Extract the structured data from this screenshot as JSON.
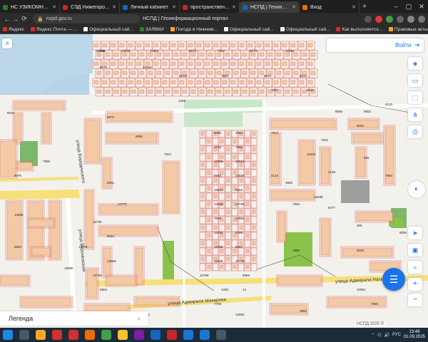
{
  "browser": {
    "tabs": [
      {
        "label": "НС УЗИКОМНО 2.4.3.",
        "color": "#2e7d32"
      },
      {
        "label": "СЭД Нижегородская",
        "color": "#c62828"
      },
      {
        "label": "Личный кабинет",
        "color": "#1565c0"
      },
      {
        "label": "пространственные д",
        "color": "#c62828"
      },
      {
        "label": "НСПД | Геоинформ",
        "color": "#1565c0",
        "active": true
      },
      {
        "label": "Вход",
        "color": "#ef6c00"
      }
    ],
    "tab_new": "+",
    "url": "nspd.gov.ru",
    "page_title": "НСПД | Геоинформационный портал",
    "bookmarks": [
      {
        "label": "Яндекс",
        "color": "#d32f2f"
      },
      {
        "label": "Яндекс.Почта — ...",
        "color": "#d32f2f"
      },
      {
        "label": "Официальный сай...",
        "color": "#ffffff"
      },
      {
        "label": "ЗАЯВКИ",
        "color": "#2e7d32"
      },
      {
        "label": "Погода в Нижнем...",
        "color": "#f9a825"
      },
      {
        "label": "Официальный сай...",
        "color": "#ffffff"
      },
      {
        "label": "Официальный сай...",
        "color": "#ffffff"
      },
      {
        "label": "Как выполняется...",
        "color": "#d32f2f"
      },
      {
        "label": "Правовые акты г...",
        "color": "#f9a825"
      },
      {
        "label": "Официальный сай...",
        "color": "#ffffff"
      }
    ]
  },
  "portal": {
    "login_label": "Войти",
    "legend_label": "Легенда",
    "copyright": "НСПД 2025 ©"
  },
  "map": {
    "street_labels": [
      {
        "text": "улица Адмирала Нахимова",
        "key": "s1"
      },
      {
        "text": "улица Адмирала Макарова",
        "key": "s2"
      },
      {
        "text": "улица Адмирала Макарова",
        "key": "s3"
      },
      {
        "text": "улица Воронежская",
        "key": "s4"
      },
      {
        "text": "улица Бородинского",
        "key": "s5"
      }
    ],
    "lot_numbers": [
      "12926",
      "13003",
      "12903",
      "8675",
      "7847",
      "8075",
      "12961",
      "8575",
      "12962",
      "13008",
      "7860",
      "8670",
      "8025",
      "7847",
      "8030",
      "1208",
      "8034",
      "8675",
      "8550",
      "7924",
      "8065",
      "4064",
      "2753",
      "7868",
      "13096",
      "12813",
      "8054",
      "14025",
      "13023",
      "8664",
      "12868",
      "12745",
      "7846",
      "12854",
      "13104",
      "8396",
      "13098",
      "8862",
      "12829",
      "12749",
      "12708",
      "8059",
      "13008",
      "8554",
      "7895",
      "9049",
      "12730",
      "8062",
      "12775",
      "13078",
      "13090",
      "12858",
      "12766",
      "8864",
      "8556",
      "8863",
      "4133",
      "4158",
      "13119",
      "8004",
      "4124",
      "3900",
      "12938",
      "8377",
      "12961",
      "7965",
      "7756",
      "12960",
      "7851",
      "7996",
      "8076",
      "7913",
      "7922",
      "565",
      "3860",
      "8002",
      "7994",
      "7994",
      "465",
      "9006",
      "1335",
      "14",
      "12968"
    ]
  },
  "taskbar": {
    "time": "13:48",
    "date": "01.09.2025",
    "lang": "РУС",
    "apps": [
      {
        "name": "start",
        "color": "#1e88e5"
      },
      {
        "name": "search",
        "color": "#455a64"
      },
      {
        "name": "files",
        "color": "#f9a825"
      },
      {
        "name": "yandex",
        "color": "#d32f2f"
      },
      {
        "name": "opera",
        "color": "#d32f2f"
      },
      {
        "name": "firefox",
        "color": "#ef6c00"
      },
      {
        "name": "chrome",
        "color": "#43a047"
      },
      {
        "name": "yandex-browser",
        "color": "#fbc02d"
      },
      {
        "name": "media",
        "color": "#7b1fa2"
      },
      {
        "name": "word",
        "color": "#1565c0"
      },
      {
        "name": "red-app",
        "color": "#c62828"
      },
      {
        "name": "app2",
        "color": "#1976d2"
      },
      {
        "name": "app3",
        "color": "#1976d2"
      },
      {
        "name": "app4",
        "color": "#455a64"
      }
    ]
  }
}
